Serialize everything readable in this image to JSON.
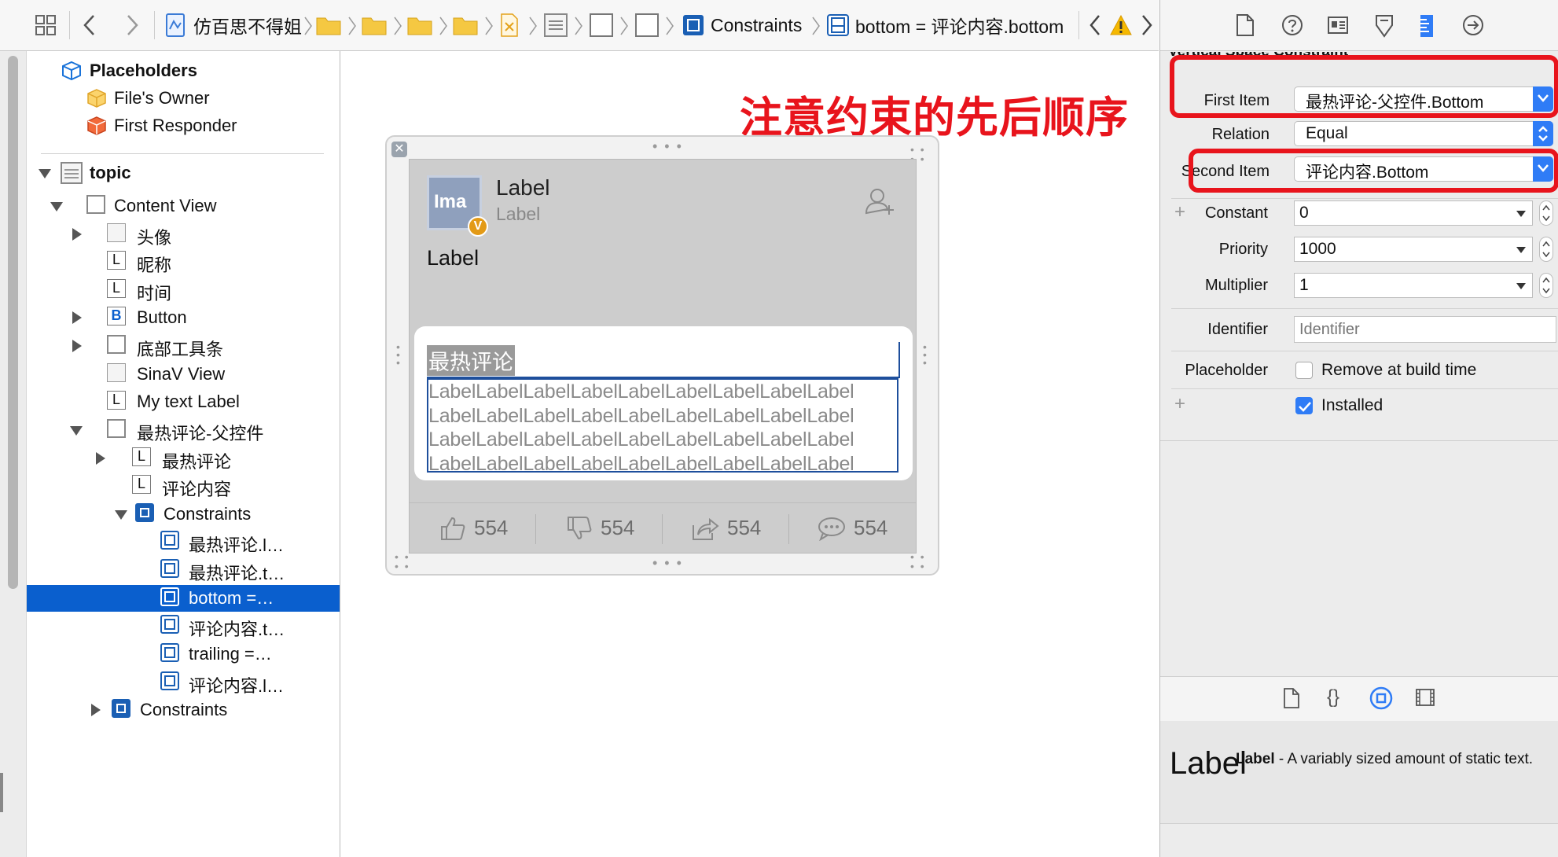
{
  "breadcrumb": {
    "project": "仿百思不得姐",
    "constraints": "Constraints",
    "selected": "bottom = 评论内容.bottom"
  },
  "outline": {
    "placeholders_title": "Placeholders",
    "files_owner": "File's Owner",
    "first_responder": "First Responder",
    "topic": "topic",
    "content_view": "Content View",
    "avatar": "头像",
    "nickname": "昵称",
    "time": "时间",
    "button": "Button",
    "bottom_toolbar": "底部工具条",
    "sinav_view": "SinaV View",
    "my_text_label": "My text Label",
    "hot_comment_parent": "最热评论-父控件",
    "hot_comment": "最热评论",
    "comment_content": "评论内容",
    "constraints_inner": "Constraints",
    "constraint_items": [
      "最热评论.l…",
      "最热评论.t…",
      "bottom =…",
      "评论内容.t…",
      "trailing =…",
      "评论内容.l…"
    ],
    "constraints_outer": "Constraints",
    "label_glyph": "L",
    "button_glyph": "B"
  },
  "canvas": {
    "annotation": "注意约束的先后顺序",
    "avatar_text": "Ima",
    "badge_text": "V",
    "name_label": "Label",
    "time_label": "Label",
    "text_label": "Label",
    "hot_title": "最热评论",
    "comment_lines": [
      "LabelLabelLabelLabelLabelLabelLabelLabelLabel",
      "LabelLabelLabelLabelLabelLabelLabelLabelLabel",
      "LabelLabelLabelLabelLabelLabelLabelLabelLabel",
      "LabelLabelLabelLabelLabelLabelLabelLabelLabel"
    ],
    "toolbar": [
      {
        "icon": "thumbs-up-icon",
        "count": "554"
      },
      {
        "icon": "thumbs-down-icon",
        "count": "554"
      },
      {
        "icon": "share-icon",
        "count": "554"
      },
      {
        "icon": "comment-icon",
        "count": "554"
      }
    ]
  },
  "inspector": {
    "section_title": "Vertical Space Constraint",
    "first_item_label": "First Item",
    "first_item_value": "最热评论-父控件.Bottom",
    "relation_label": "Relation",
    "relation_value": "Equal",
    "second_item_label": "Second Item",
    "second_item_value": "评论内容.Bottom",
    "constant_label": "Constant",
    "constant_value": "0",
    "priority_label": "Priority",
    "priority_value": "1000",
    "multiplier_label": "Multiplier",
    "multiplier_value": "1",
    "identifier_label": "Identifier",
    "identifier_placeholder": "Identifier",
    "placeholder_label": "Placeholder",
    "remove_at_build": "Remove at build time",
    "installed": "Installed",
    "plus": "+"
  },
  "library": {
    "preview": "Label",
    "name": "Label",
    "description": " - A variably sized amount of static text."
  },
  "colors": {
    "selection": "#0a5fce",
    "annotation_red": "#e8141c",
    "accent_blue": "#2f7cf6"
  }
}
